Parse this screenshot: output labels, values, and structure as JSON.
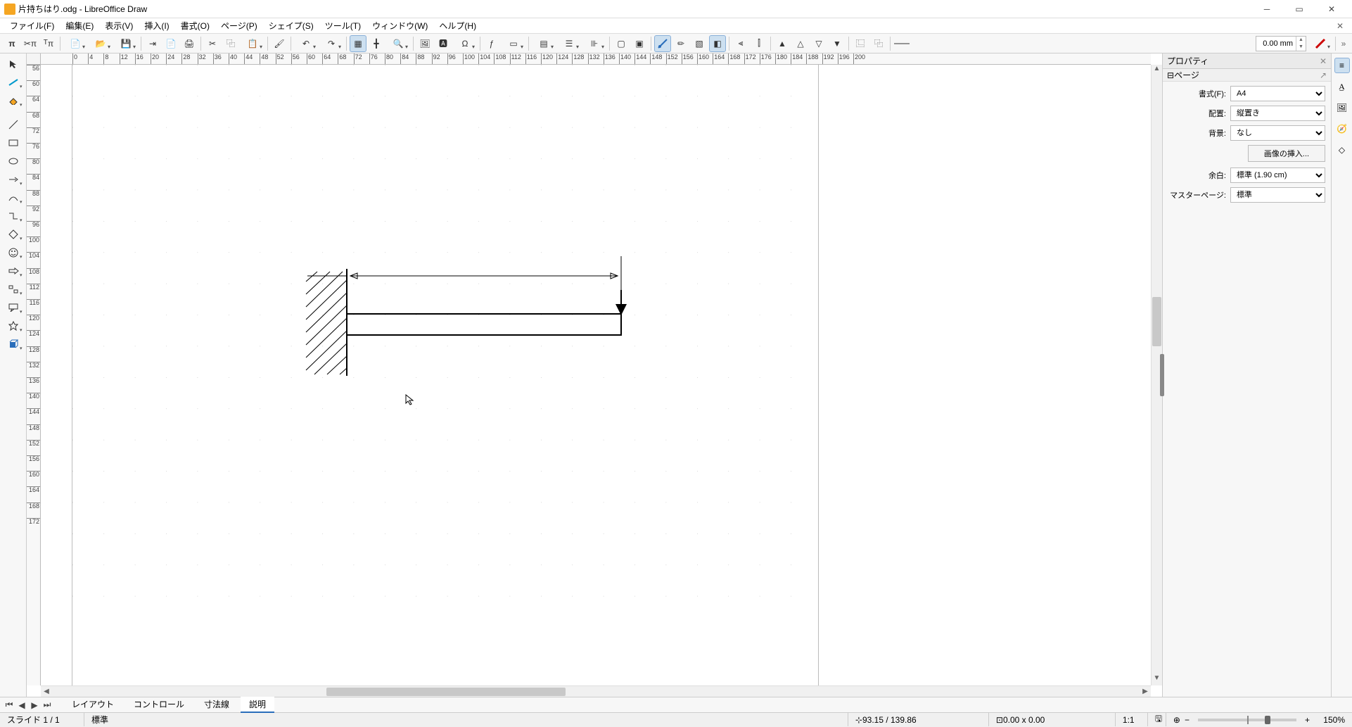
{
  "window": {
    "title": "片持ちはり.odg - LibreOffice Draw"
  },
  "menu": {
    "file": "ファイル(F)",
    "edit": "編集(E)",
    "view": "表示(V)",
    "insert": "挿入(I)",
    "format": "書式(O)",
    "page": "ページ(P)",
    "shape": "シェイプ(S)",
    "tool": "ツール(T)",
    "window": "ウィンドウ(W)",
    "help": "ヘルプ(H)"
  },
  "toolbar": {
    "line_width": "0.00 mm"
  },
  "sidebar": {
    "title": "プロパティ",
    "section": "ページ",
    "labels": {
      "format": "書式(F):",
      "orientation": "配置:",
      "background": "背景:",
      "margin": "余白:",
      "master": "マスターページ:"
    },
    "values": {
      "format": "A4",
      "orientation": "縦置き",
      "background": "なし",
      "margin": "標準 (1.90 cm)",
      "master": "標準"
    },
    "insert_image": "画像の挿入..."
  },
  "tabs": {
    "layout": "レイアウト",
    "control": "コントロール",
    "dimension": "寸法線",
    "description": "説明"
  },
  "status": {
    "slide": "スライド 1 / 1",
    "style": "標準",
    "coords": "93.15 / 139.86",
    "size": "0.00 x 0.00",
    "ratio": "1:1",
    "zoom": "150%"
  },
  "ruler_h": [
    0,
    4,
    8,
    12,
    16,
    20,
    24,
    28,
    32,
    36,
    40,
    44,
    48,
    52,
    56,
    60,
    64,
    68,
    72,
    76,
    80,
    84,
    88,
    92,
    96,
    100,
    104,
    108,
    112,
    116,
    120,
    124,
    128,
    132,
    136,
    140,
    144,
    148,
    152,
    156,
    160,
    164,
    168,
    172,
    176,
    180,
    184,
    188,
    192,
    196,
    200
  ],
  "ruler_v": [
    56,
    60,
    64,
    68,
    72,
    76,
    80,
    84,
    88,
    92,
    96,
    100,
    104,
    108,
    112,
    116,
    120,
    124,
    128,
    132,
    136,
    140,
    144,
    148,
    152,
    156,
    160,
    164,
    168,
    172
  ]
}
